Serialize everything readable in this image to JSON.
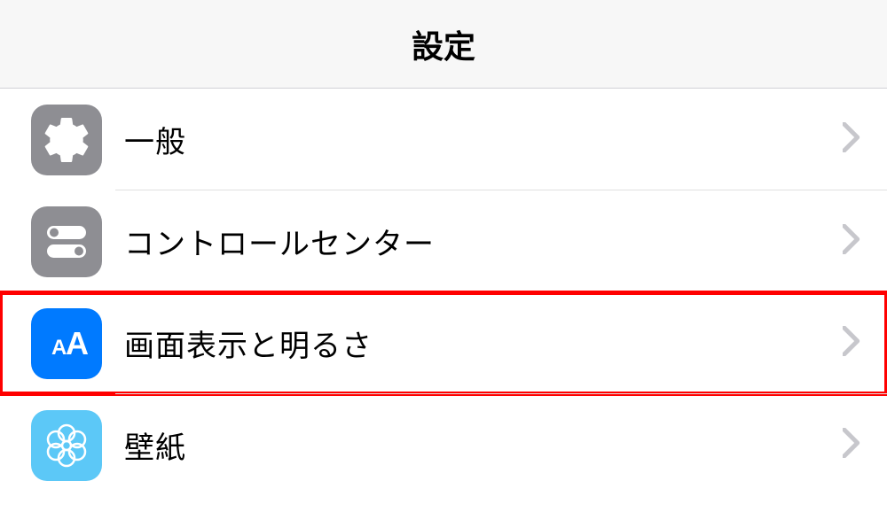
{
  "header": {
    "title": "設定"
  },
  "rows": {
    "general": {
      "label": "一般"
    },
    "control_center": {
      "label": "コントロールセンター"
    },
    "display_brightness": {
      "label": "画面表示と明るさ"
    },
    "wallpaper": {
      "label": "壁紙"
    }
  },
  "colors": {
    "gray_icon": "#8e8e93",
    "blue_icon": "#007aff",
    "lightblue_icon": "#5cc8f7",
    "highlight": "#ff0000",
    "chevron": "#c7c7cc",
    "divider": "#e0e0e0"
  }
}
